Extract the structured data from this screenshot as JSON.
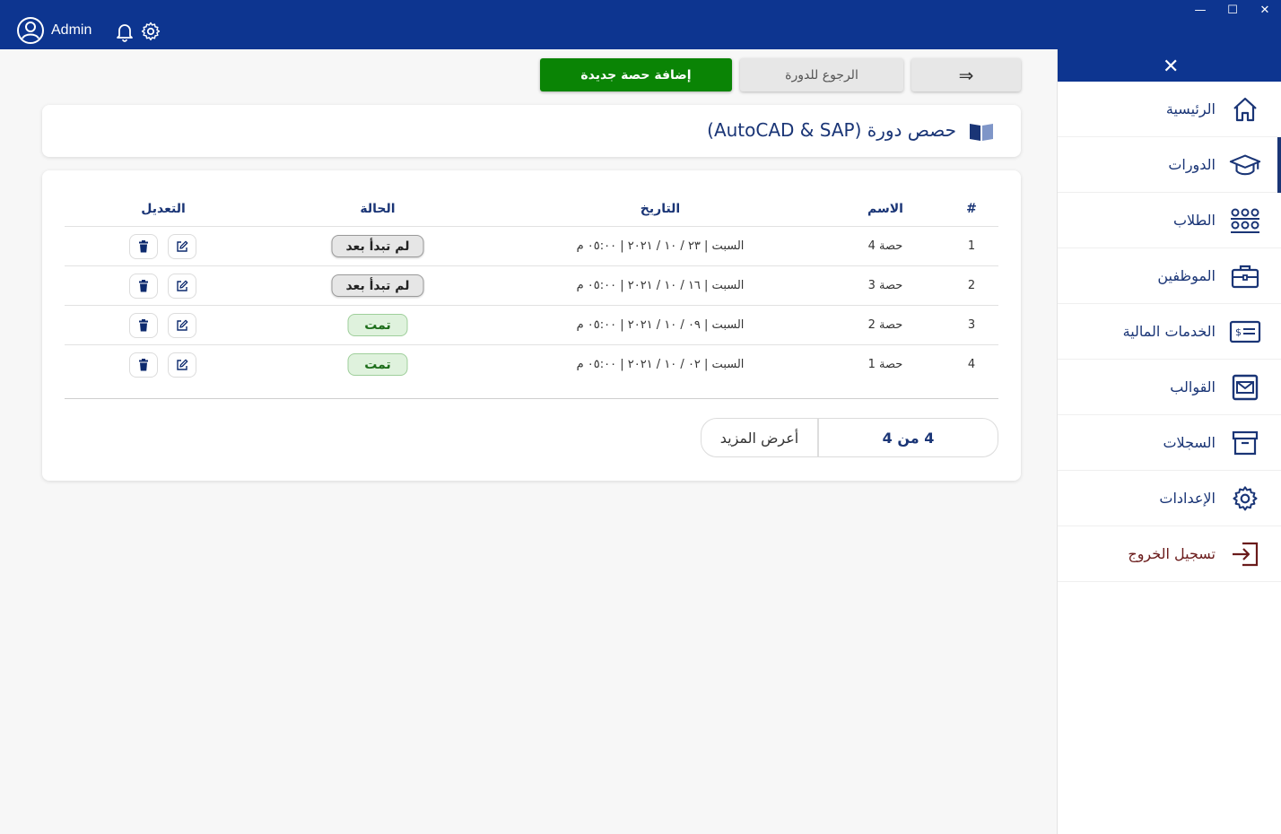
{
  "header": {
    "user_name": "Admin"
  },
  "window_controls": {
    "minimize": "—",
    "maximize": "☐",
    "close": "✕"
  },
  "sidebar": {
    "close": "✕",
    "items": [
      {
        "label": "الرئيسية",
        "icon": "home-icon"
      },
      {
        "label": "الدورات",
        "icon": "graduation-cap-icon",
        "active": true
      },
      {
        "label": "الطلاب",
        "icon": "students-icon"
      },
      {
        "label": "الموظفين",
        "icon": "briefcase-icon"
      },
      {
        "label": "الخدمات المالية",
        "icon": "money-card-icon"
      },
      {
        "label": "القوالب",
        "icon": "envelope-icon"
      },
      {
        "label": "السجلات",
        "icon": "archive-icon"
      },
      {
        "label": "الإعدادات",
        "icon": "gear-icon"
      },
      {
        "label": "تسجيل الخروج",
        "icon": "logout-icon"
      }
    ]
  },
  "actions": {
    "add_label": "إضافة حصة جديدة",
    "back_label": "الرجوع للدورة",
    "forward_label": "⇒"
  },
  "page": {
    "title": "حصص دورة (AutoCAD & SAP)"
  },
  "table": {
    "headers": {
      "num": "#",
      "name": "الاسم",
      "date": "التاريخ",
      "status": "الحالة",
      "edit": "التعديل"
    },
    "rows": [
      {
        "num": "1",
        "name": "حصة 4",
        "date": "السبت | ٢٣ / ١٠ / ٢٠٢١ | ٠٥:٠٠ م",
        "status": "لم تبدأ بعد",
        "status_type": "pending"
      },
      {
        "num": "2",
        "name": "حصة 3",
        "date": "السبت | ١٦ / ١٠ / ٢٠٢١ | ٠٥:٠٠ م",
        "status": "لم تبدأ بعد",
        "status_type": "pending"
      },
      {
        "num": "3",
        "name": "حصة 2",
        "date": "السبت | ٠٩ / ١٠ / ٢٠٢١ | ٠٥:٠٠ م",
        "status": "تمت",
        "status_type": "done"
      },
      {
        "num": "4",
        "name": "حصة 1",
        "date": "السبت | ٠٢ / ١٠ / ٢٠٢١ | ٠٥:٠٠ م",
        "status": "تمت",
        "status_type": "done"
      }
    ]
  },
  "pager": {
    "more_label": "أعرض المزيد",
    "count_label": "4 من 4"
  },
  "colors": {
    "primary": "#0d3590",
    "add_button": "#0a8405",
    "done_bg": "#dff2dd",
    "pending_bg": "#e6e6e6"
  }
}
